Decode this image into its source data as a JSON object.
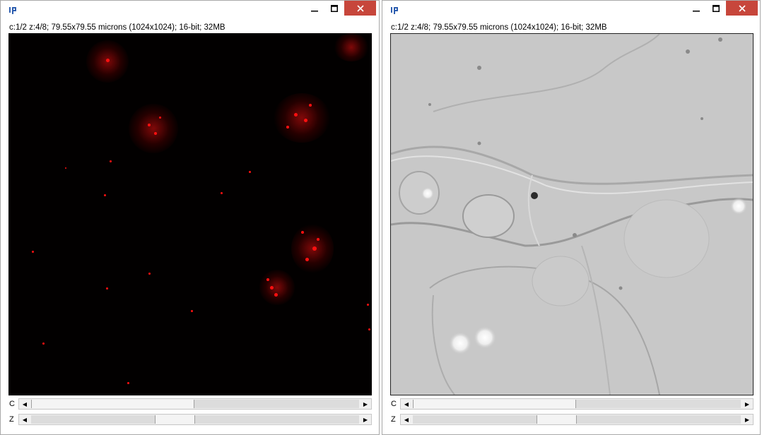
{
  "windows": [
    {
      "info": "c:1/2 z:4/8; 79.55x79.55 microns (1024x1024); 16-bit; 32MB",
      "sliders": [
        {
          "label": "C",
          "value_fraction": 0.5
        },
        {
          "label": "Z",
          "value_fraction": 0.375
        }
      ]
    },
    {
      "info": "c:1/2 z:4/8; 79.55x79.55 microns (1024x1024); 16-bit; 32MB",
      "sliders": [
        {
          "label": "C",
          "value_fraction": 0.5
        },
        {
          "label": "Z",
          "value_fraction": 0.375
        }
      ]
    }
  ],
  "colors": {
    "close_button": "#c7463b",
    "fluorescence_spot": "#ff1010",
    "brightfield_bg": "#c9c9c9"
  },
  "icons": {
    "app": "imagej-icon",
    "minimize": "minimize-icon",
    "maximize": "maximize-icon",
    "close": "close-icon",
    "arrow_left": "arrow-left-icon",
    "arrow_right": "arrow-right-icon"
  }
}
